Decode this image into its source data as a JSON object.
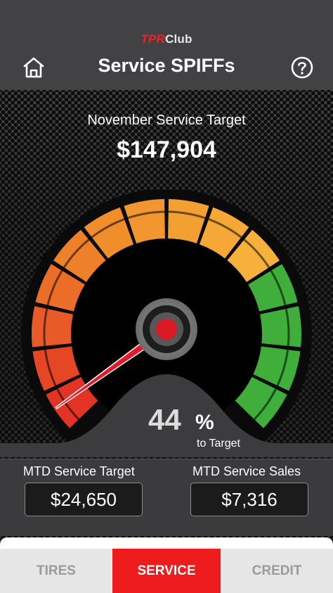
{
  "header": {
    "brand_prefix": "TPR",
    "brand_suffix": "Club",
    "title": "Service SPIFFs",
    "home_icon": "home-icon",
    "help_icon": "question-circle-icon"
  },
  "target": {
    "label": "November Service Target",
    "value": "$147,904"
  },
  "gauge": {
    "percent_value": 44,
    "percent_number": "44",
    "percent_symbol": "%",
    "caption": "to Target",
    "colors": {
      "red": "#e23424",
      "orange": "#f08a2a",
      "yellow": "#f6b13a",
      "green": "#3fae3a",
      "needle": "#e21a2a"
    }
  },
  "stats": {
    "mtd_target_label": "MTD Service Target",
    "mtd_target_value": "$24,650",
    "mtd_sales_label": "MTD Service Sales",
    "mtd_sales_value": "$7,316"
  },
  "tabs": [
    {
      "label": "TIRES",
      "active": false
    },
    {
      "label": "SERVICE",
      "active": true
    },
    {
      "label": "CREDIT",
      "active": false
    }
  ]
}
